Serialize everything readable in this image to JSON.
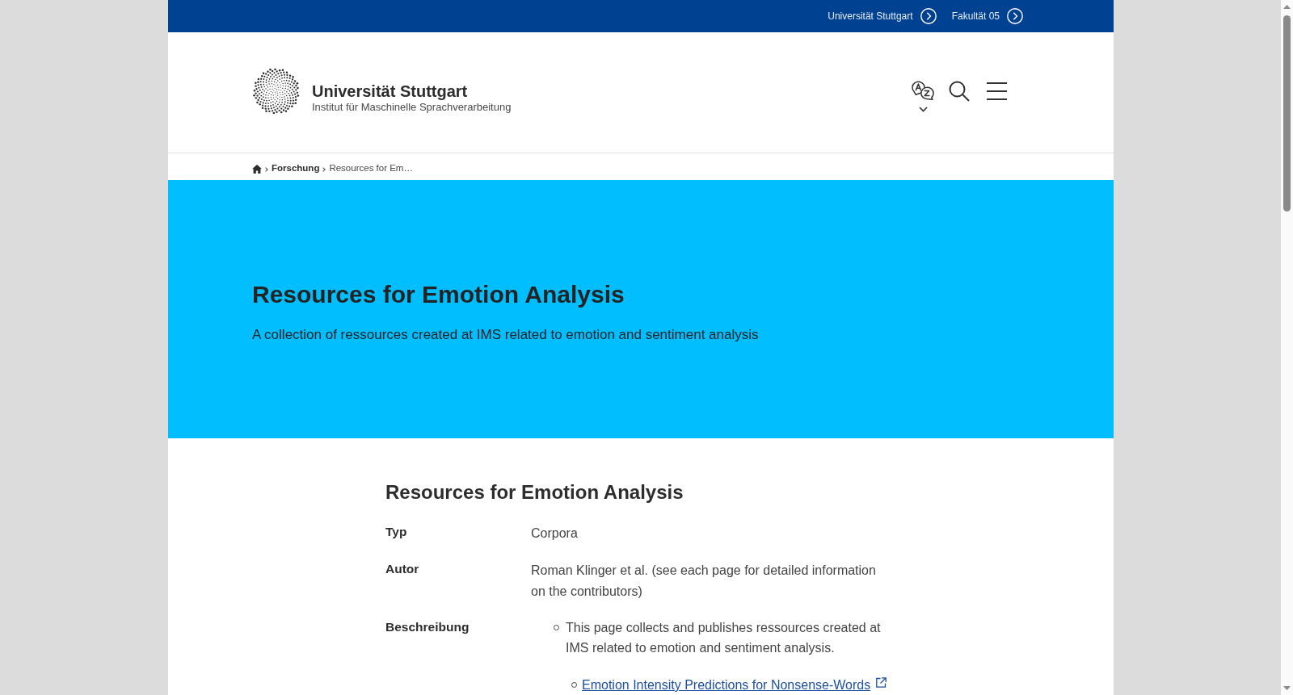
{
  "top_bar": {
    "links": [
      {
        "label": "Universität Stuttgart"
      },
      {
        "label": "Fakultät 05"
      }
    ]
  },
  "header": {
    "logo_title": "Universität Stuttgart",
    "logo_subtitle": "Institut für Maschinelle Sprachverarbeitung"
  },
  "breadcrumb": [
    {
      "kind": "home"
    },
    {
      "kind": "link",
      "label": "Forschung"
    },
    {
      "kind": "current",
      "label": "Resources for Em…"
    }
  ],
  "hero": {
    "title": "Resources for Emotion Analysis",
    "subtitle": "A collection of ressources created at IMS related to emotion and sentiment analysis"
  },
  "content": {
    "title": "Resources for Emotion Analysis",
    "fields": [
      {
        "label": "Typ",
        "value": "Corpora"
      },
      {
        "label": "Autor",
        "value": "Roman Klinger et al. (see each page for detailed information on the contributors)"
      },
      {
        "label": "Beschreibung",
        "items": [
          {
            "kind": "text",
            "text": "This page collects and publishes ressources created at IMS related to emotion and sentiment analysis."
          },
          {
            "kind": "link",
            "text": "Emotion Intensity Predictions for Nonsense-Words"
          }
        ]
      }
    ]
  }
}
